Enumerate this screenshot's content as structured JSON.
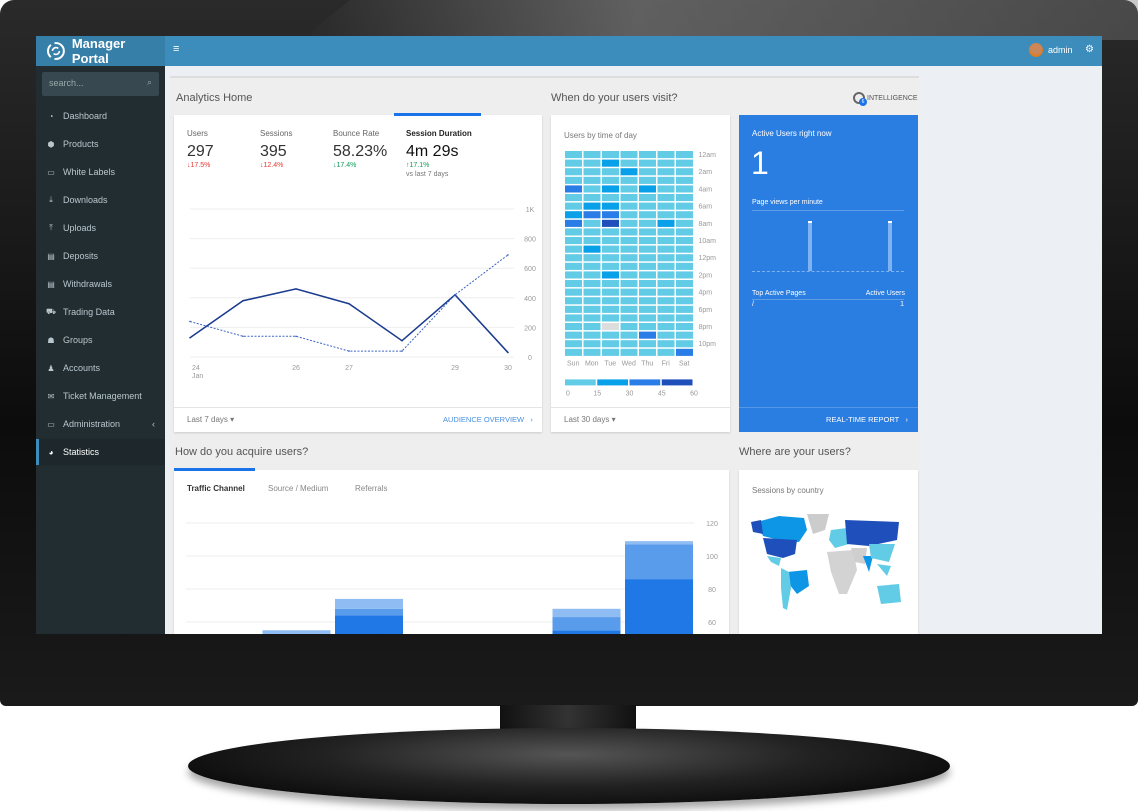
{
  "app": {
    "title": "Manager Portal",
    "menu_icon": "hamburger-icon",
    "user": "admin",
    "settings_icon": "cogs-icon"
  },
  "sidebar": {
    "search_placeholder": "search...",
    "items": [
      {
        "label": "Dashboard",
        "icon": "dashboard-icon"
      },
      {
        "label": "Products",
        "icon": "cube-icon"
      },
      {
        "label": "White Labels",
        "icon": "folder-icon"
      },
      {
        "label": "Downloads",
        "icon": "download-icon"
      },
      {
        "label": "Uploads",
        "icon": "upload-icon"
      },
      {
        "label": "Deposits",
        "icon": "credit-card-icon"
      },
      {
        "label": "Withdrawals",
        "icon": "credit-card-icon"
      },
      {
        "label": "Trading Data",
        "icon": "cart-icon"
      },
      {
        "label": "Groups",
        "icon": "users-icon"
      },
      {
        "label": "Accounts",
        "icon": "user-icon"
      },
      {
        "label": "Ticket Management",
        "icon": "envelope-icon"
      },
      {
        "label": "Administration",
        "icon": "monitor-icon",
        "chevron": "‹"
      },
      {
        "label": "Statistics",
        "icon": "tachometer-icon",
        "active": true
      }
    ]
  },
  "analytics": {
    "title": "Analytics Home",
    "metrics": [
      {
        "label": "Users",
        "value": "297",
        "change": "↓17.5%",
        "trend": "down"
      },
      {
        "label": "Sessions",
        "value": "395",
        "change": "↓12.4%",
        "trend": "down"
      },
      {
        "label": "Bounce Rate",
        "value": "58.23%",
        "change": "↓17.4%",
        "trend": "good"
      },
      {
        "label": "Session Duration",
        "value": "4m 29s",
        "change": "↑17.1%",
        "trend": "up",
        "note": "vs last 7 days",
        "selected": true
      }
    ],
    "range": "Last 7 days",
    "link": "AUDIENCE OVERVIEW"
  },
  "visits": {
    "title": "When do your users visit?",
    "intelligence": "INTELLIGENCE",
    "intelligence_badge": "6",
    "subtitle": "Users by time of day",
    "range": "Last 30 days"
  },
  "realtime": {
    "title": "Active Users right now",
    "count": "1",
    "pageviews_label": "Page views per minute",
    "pages_label": "Top Active Pages",
    "users_label": "Active Users",
    "page": "/",
    "page_users": "1",
    "link": "REAL-TIME REPORT",
    "pageview_spikes": [
      1,
      1
    ]
  },
  "acquire": {
    "title": "How do you acquire users?",
    "tabs": [
      "Traffic Channel",
      "Source / Medium",
      "Referrals"
    ],
    "active_tab": 0
  },
  "where": {
    "title": "Where are your users?",
    "subtitle": "Sessions by country"
  },
  "colors": {
    "header": "#3c8dbc",
    "sidebar": "#222d32",
    "accent": "#1a73e8",
    "realtime": "#2a7de1",
    "down": "#e53935",
    "up": "#0f9d58"
  },
  "chart_data": [
    {
      "type": "line",
      "x": [
        "24 Jan",
        "25",
        "26",
        "27",
        "28",
        "29",
        "30"
      ],
      "xtick_labels": [
        "24",
        "Jan",
        "26",
        "27",
        "29",
        "30"
      ],
      "yticks": [
        "0",
        "200",
        "400",
        "600",
        "800",
        "1K"
      ],
      "ylim": [
        0,
        1000
      ],
      "grid": true,
      "series": [
        {
          "style": "solid",
          "values": [
            130,
            380,
            460,
            360,
            110,
            420,
            30
          ]
        },
        {
          "style": "dotted",
          "values": [
            240,
            140,
            140,
            40,
            40,
            420,
            690
          ]
        }
      ]
    },
    {
      "type": "heatmap",
      "columns": [
        "Sun",
        "Mon",
        "Tue",
        "Wed",
        "Thu",
        "Fri",
        "Sat"
      ],
      "rows": [
        "12am",
        "1am",
        "2am",
        "3am",
        "4am",
        "5am",
        "6am",
        "7am",
        "8am",
        "9am",
        "10am",
        "11am",
        "12pm",
        "1pm",
        "2pm",
        "3pm",
        "4pm",
        "5pm",
        "6pm",
        "7pm",
        "8pm",
        "9pm",
        "10pm",
        "11pm"
      ],
      "row_labels_shown": [
        "12am",
        "2am",
        "4am",
        "6am",
        "8am",
        "10am",
        "12pm",
        "2pm",
        "4pm",
        "6pm",
        "8pm",
        "10pm"
      ],
      "legend": [
        "0",
        "15",
        "30",
        "45",
        "60"
      ],
      "levels": [
        [
          0,
          0,
          0,
          0,
          0,
          0,
          0
        ],
        [
          0,
          0,
          1,
          0,
          0,
          0,
          0
        ],
        [
          0,
          0,
          0,
          1,
          0,
          0,
          0
        ],
        [
          0,
          0,
          0,
          0,
          0,
          0,
          0
        ],
        [
          2,
          0,
          1,
          0,
          1,
          0,
          0
        ],
        [
          0,
          0,
          0,
          0,
          0,
          0,
          0
        ],
        [
          0,
          1,
          1,
          0,
          0,
          0,
          0
        ],
        [
          1,
          2,
          2,
          0,
          0,
          0,
          0
        ],
        [
          2,
          0,
          3,
          0,
          0,
          1,
          0
        ],
        [
          0,
          0,
          0,
          0,
          0,
          0,
          0
        ],
        [
          0,
          0,
          0,
          0,
          0,
          0,
          0
        ],
        [
          0,
          1,
          0,
          0,
          0,
          0,
          0
        ],
        [
          0,
          0,
          0,
          0,
          0,
          0,
          0
        ],
        [
          0,
          0,
          0,
          0,
          0,
          0,
          0
        ],
        [
          0,
          0,
          1,
          0,
          0,
          0,
          0
        ],
        [
          0,
          0,
          0,
          0,
          0,
          0,
          0
        ],
        [
          0,
          0,
          0,
          0,
          0,
          0,
          0
        ],
        [
          0,
          0,
          0,
          0,
          0,
          0,
          0
        ],
        [
          0,
          0,
          0,
          0,
          0,
          0,
          0
        ],
        [
          0,
          0,
          0,
          0,
          0,
          0,
          0
        ],
        [
          0,
          0,
          -1,
          0,
          0,
          0,
          0
        ],
        [
          0,
          0,
          0,
          0,
          2,
          0,
          0
        ],
        [
          0,
          0,
          0,
          0,
          0,
          0,
          0
        ],
        [
          0,
          0,
          0,
          0,
          0,
          0,
          2
        ]
      ],
      "palette": [
        "#62cbe6",
        "#08a0e8",
        "#2a7ce6",
        "#1e4fba"
      ]
    },
    {
      "type": "bar",
      "stacked": true,
      "yticks": [
        "60",
        "80",
        "100",
        "120"
      ],
      "ylim": [
        0,
        120
      ],
      "grid": true,
      "series": [
        {
          "values": [
            48,
            50,
            64,
            0,
            0,
            55,
            86
          ],
          "color": "#1f78e6"
        },
        {
          "values": [
            2,
            2,
            4,
            0,
            0,
            8,
            21
          ],
          "color": "#5a9cec"
        },
        {
          "values": [
            2,
            3,
            6,
            0,
            0,
            5,
            2
          ],
          "color": "#8fbcf2"
        }
      ]
    }
  ]
}
